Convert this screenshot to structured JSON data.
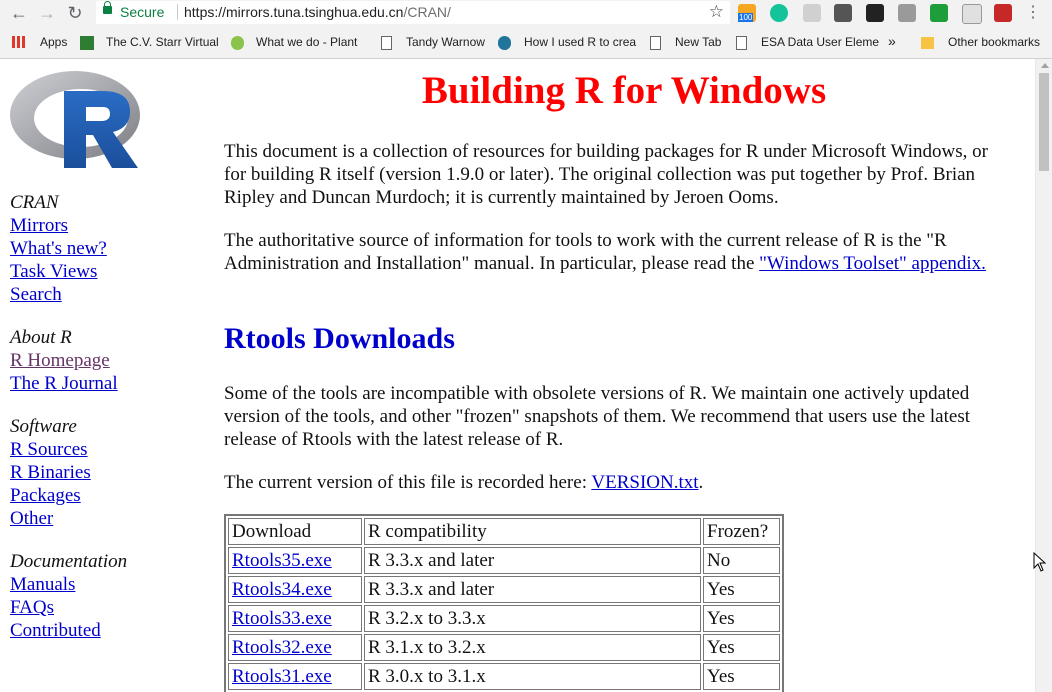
{
  "browser": {
    "secure_label": "Secure",
    "url_base": "https://mirrors.tuna.tsinghua.edu.cn",
    "url_path": "/CRAN/",
    "extension_badge": "100"
  },
  "bookmarks": [
    {
      "label": "Apps"
    },
    {
      "label": "The C.V. Starr Virtual"
    },
    {
      "label": "What we do - Plant"
    },
    {
      "label": "Tandy Warnow"
    },
    {
      "label": "How I used R to crea"
    },
    {
      "label": "New Tab"
    },
    {
      "label": "ESA Data User Eleme"
    },
    {
      "label": "»"
    },
    {
      "label": "Other bookmarks"
    }
  ],
  "sidebar": {
    "cran_heading": "CRAN",
    "cran_links": [
      "Mirrors",
      "What's new?",
      "Task Views",
      "Search"
    ],
    "about_heading": "About R",
    "about_links": [
      "R Homepage",
      "The R Journal"
    ],
    "software_heading": "Software",
    "software_links": [
      "R Sources",
      "R Binaries",
      "Packages",
      "Other"
    ],
    "doc_heading": "Documentation",
    "doc_links": [
      "Manuals",
      "FAQs",
      "Contributed"
    ]
  },
  "main": {
    "title": "Building R for Windows",
    "intro": "This document is a collection of resources for building packages for R under Microsoft Windows, or for building R itself (version 1.9.0 or later). The original collection was put together by Prof. Brian Ripley and Duncan Murdoch; it is currently maintained by Jeroen Ooms.",
    "auth_text": "The authoritative source of information for tools to work with the current release of R is the \"R Administration and Installation\" manual. In particular, please read the ",
    "auth_link": "\"Windows Toolset\" appendix.",
    "rtools_heading": "Rtools Downloads",
    "compat_text": "Some of the tools are incompatible with obsolete versions of R. We maintain one actively updated version of the tools, and other \"frozen\" snapshots of them. We recommend that users use the latest release of Rtools with the latest release of R.",
    "version_text": "The current version of this file is recorded here: ",
    "version_link": "VERSION.txt",
    "version_end": "."
  },
  "table": {
    "headers": [
      "Download",
      "R compatibility",
      "Frozen?"
    ],
    "rows": [
      [
        "Rtools35.exe",
        "R 3.3.x and later",
        "No"
      ],
      [
        "Rtools34.exe",
        "R 3.3.x and later",
        "Yes"
      ],
      [
        "Rtools33.exe",
        "R 3.2.x to 3.3.x",
        "Yes"
      ],
      [
        "Rtools32.exe",
        "R 3.1.x to 3.2.x",
        "Yes"
      ],
      [
        "Rtools31.exe",
        "R 3.0.x to 3.1.x",
        "Yes"
      ]
    ]
  },
  "colors": {
    "title": "#ff0000",
    "heading": "#0000cc",
    "link": "#0000cc",
    "visited": "#663366"
  }
}
